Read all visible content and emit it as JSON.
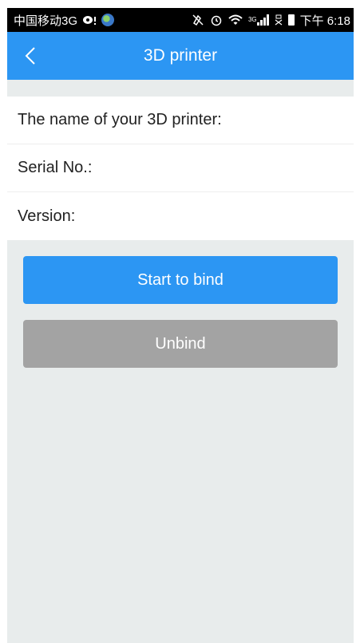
{
  "status_bar": {
    "carrier": "中国移动3G",
    "network_label": "3G",
    "clock": "下午 6:18"
  },
  "header": {
    "title": "3D printer",
    "back_icon": "chevron-left-icon"
  },
  "info": {
    "printer_name_label": "The name of your 3D printer:",
    "serial_label": "Serial No.:",
    "version_label": "Version:"
  },
  "actions": {
    "bind_label": "Start to bind",
    "unbind_label": "Unbind"
  },
  "colors": {
    "accent": "#2c96f3",
    "disabled": "#a3a3a3",
    "background": "#e8ecec"
  }
}
